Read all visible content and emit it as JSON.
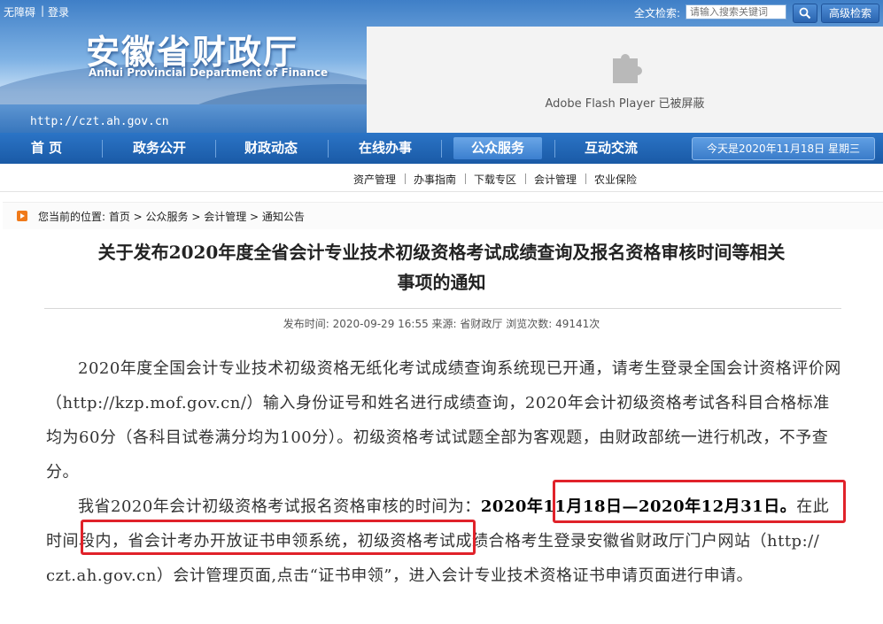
{
  "header": {
    "accessibility_link": "无障碍",
    "util_separator": "|",
    "login_link": "登录",
    "title": "安徽省财政厅",
    "subtitle": "Anhui Provincial Department of Finance",
    "url": "http://czt.ah.gov.cn",
    "search_label": "全文检索:",
    "search_placeholder": "请输入搜索关键词",
    "search_icon": "magnifier-icon",
    "advanced_search": "高级检索",
    "flash_icon": "puzzle-piece-icon",
    "flash_message": "Adobe Flash Player 已被屏蔽"
  },
  "nav": {
    "items": [
      {
        "label": "首  页"
      },
      {
        "label": "政务公开"
      },
      {
        "label": "财政动态"
      },
      {
        "label": "在线办事"
      },
      {
        "label": "公众服务"
      },
      {
        "label": "互动交流"
      }
    ],
    "active_index": 4,
    "date": "今天是2020年11月18日  星期三"
  },
  "subnav": {
    "items": [
      {
        "label": "资产管理"
      },
      {
        "label": "办事指南"
      },
      {
        "label": "下载专区"
      },
      {
        "label": "会计管理"
      },
      {
        "label": "农业保险"
      }
    ]
  },
  "breadcrumb": {
    "text": "您当前的位置: 首页 > 公众服务 > 会计管理 > 通知公告"
  },
  "article": {
    "title_line1": "关于发布2020年度全省会计专业技术初级资格考试成绩查询及报名资格审核时间等相关",
    "title_line2": "事项的通知",
    "meta": "发布时间: 2020-09-29 16:55  来源: 省财政厅  浏览次数: 49141次",
    "para1": "2020年度全国会计专业技术初级资格无纸化考试成绩查询系统现已开通，请考生登录全国会计资格评价网（http://kzp.mof.gov.cn/）输入身份证号和姓名进行成绩查询，2020年会计初级资格考试各科目合格标准均为60分（各科目试卷满分均为100分）。初级资格考试试题全部为客观题，由财政部统一进行机改，不予查分。",
    "para2_intro": "我省2020年会计初级资格考试报名资格审核的时间为：",
    "para2_dates": "2020年11月18日—2020年12月31日。",
    "para2_system": "在此时间段内，省会计考办开放证书申领系统，",
    "para2_rest": "初级资格考试成绩合格考生登录安徽省财政厅门户网站（http:// czt.ah.gov.cn）会计管理页面,点击“证书申领”，进入会计专业技术资格证书申请页面进行申请。"
  },
  "colors": {
    "nav_blue": "#1a5aa6",
    "highlight_red": "#e0222a",
    "breadcrumb_orange": "#f07a1a"
  }
}
